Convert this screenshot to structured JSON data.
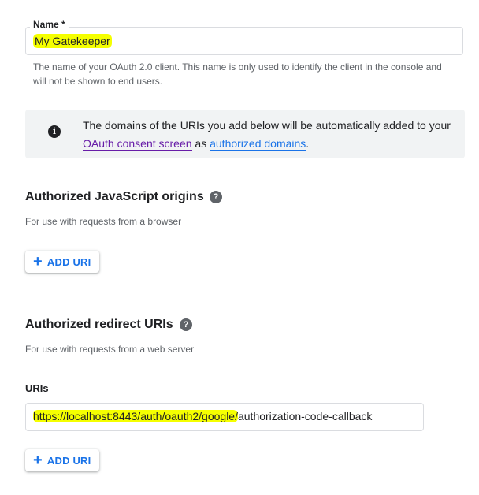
{
  "name_field": {
    "label": "Name *",
    "value": "My Gatekeeper",
    "helper": "The name of your OAuth 2.0 client. This name is only used to identify the client in the console and will not be shown to end users."
  },
  "info_banner": {
    "icon": "info-icon",
    "text_before": "The domains of the URIs you add below will be automatically added to your ",
    "link1": "OAuth consent screen",
    "text_middle": " as ",
    "link2": "authorized domains",
    "text_after": "."
  },
  "js_origins": {
    "title": "Authorized JavaScript origins",
    "help_icon": "?",
    "subtitle": "For use with requests from a browser",
    "add_label": "ADD URI"
  },
  "redirect_uris": {
    "title": "Authorized redirect URIs",
    "help_icon": "?",
    "subtitle": "For use with requests from a web server",
    "field_label": "URIs",
    "value_highlighted": "https://localhost:8443/auth/oauth2/google/",
    "value_rest": "authorization-code-callback",
    "add_label": "ADD URI"
  },
  "colors": {
    "accent": "#1a73e8",
    "visited_link": "#681da8",
    "highlight": "#f5ff00",
    "banner_bg": "#f1f3f4"
  }
}
